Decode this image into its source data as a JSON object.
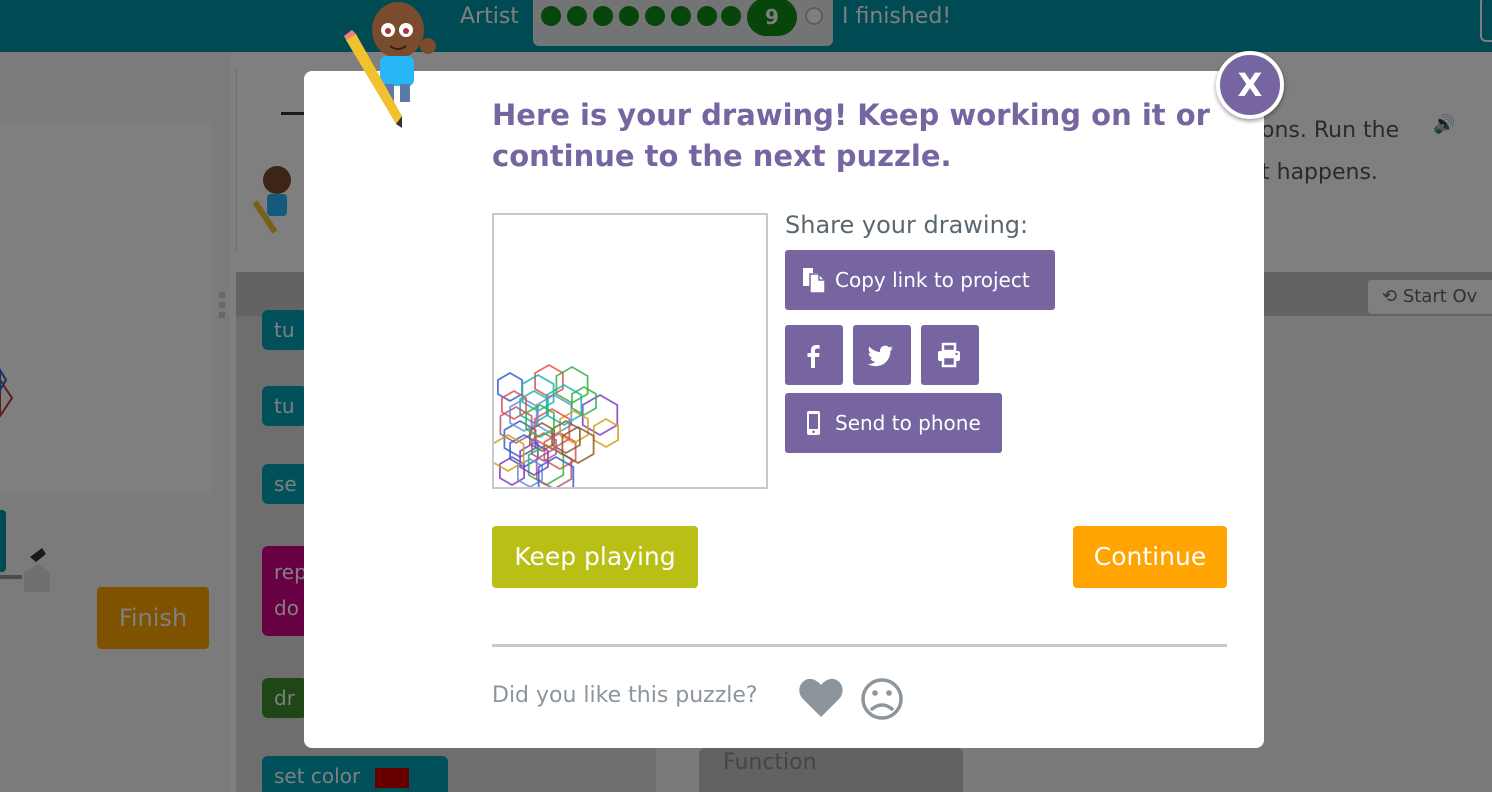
{
  "topbar": {
    "level_name": "Artist",
    "current_level": "9",
    "finished_label": "I finished!"
  },
  "left_panel": {
    "finish_button": "Finish"
  },
  "instructions": {
    "line1": "ons. Run the",
    "line2": "t happens."
  },
  "workspace": {
    "start_over": "Start Ov",
    "blocks": [
      "tu",
      "tu",
      "se",
      "rep",
      "do",
      "dr",
      "set color"
    ],
    "function_label": "Function"
  },
  "modal": {
    "heading": "Here is your drawing! Keep working on it or continue to the next puzzle.",
    "close_label": "X",
    "share_label": "Share your drawing:",
    "copy_link_label": "Copy link to project",
    "send_to_phone_label": "Send to phone",
    "keep_playing_label": "Keep playing",
    "continue_label": "Continue",
    "feedback_question": "Did you like this puzzle?"
  },
  "icons": {
    "close": "close-icon",
    "copy": "copy-icon",
    "facebook": "facebook-icon",
    "twitter": "twitter-icon",
    "print": "print-icon",
    "phone": "phone-icon",
    "like": "heart-icon",
    "dislike": "frown-icon"
  },
  "colors": {
    "topbar": "#0094a6",
    "purple": "#7665a0",
    "keep_playing": "#b9bf15",
    "continue": "#ffa400"
  }
}
